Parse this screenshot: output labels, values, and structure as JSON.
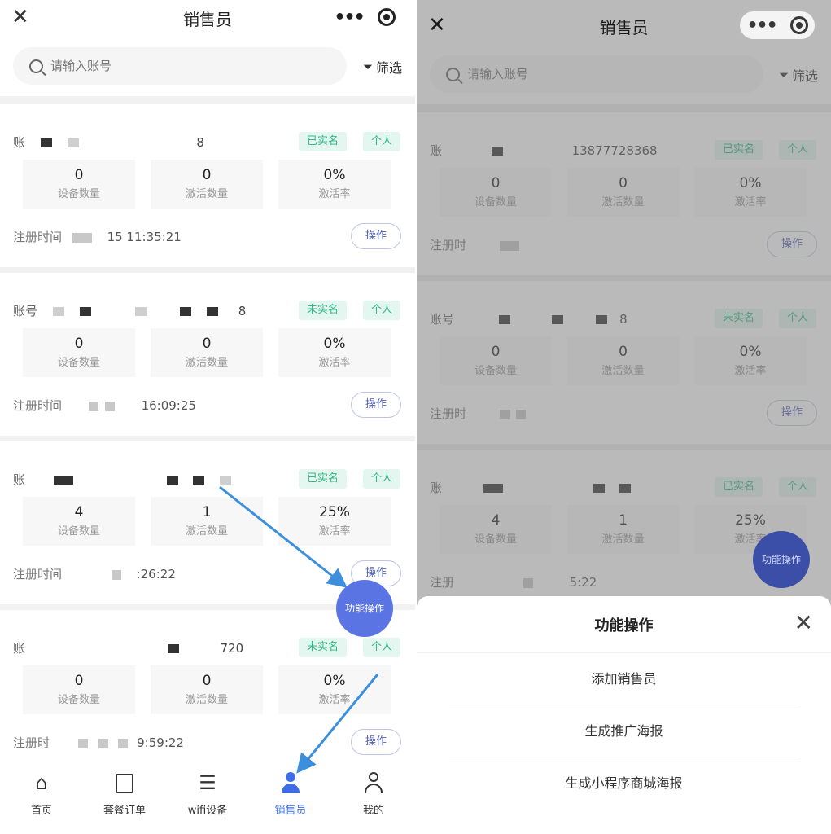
{
  "nav": {
    "title": "销售员",
    "close_icon": "close-icon",
    "more_icon": "more-dots-icon",
    "target_icon": "target-icon"
  },
  "search": {
    "placeholder": "请输入账号",
    "filter_label": "筛选"
  },
  "cards": [
    {
      "acct_label": "账",
      "acct_tail": "8",
      "verify": "已实名",
      "type": "个人",
      "devices": "0",
      "devices_label": "设备数量",
      "activated": "0",
      "activated_label": "激活数量",
      "rate": "0%",
      "rate_label": "激活率",
      "reg_label": "注册时间",
      "reg_time": "15 11:35:21",
      "op": "操作"
    },
    {
      "acct_label": "账号",
      "acct_tail": "8",
      "verify": "未实名",
      "type": "个人",
      "devices": "0",
      "devices_label": "设备数量",
      "activated": "0",
      "activated_label": "激活数量",
      "rate": "0%",
      "rate_label": "激活率",
      "reg_label": "注册时间",
      "reg_time": "16:09:25",
      "op": "操作"
    },
    {
      "acct_label": "账",
      "acct_tail": "",
      "verify": "已实名",
      "type": "个人",
      "devices": "4",
      "devices_label": "设备数量",
      "activated": "1",
      "activated_label": "激活数量",
      "rate": "25%",
      "rate_label": "激活率",
      "reg_label": "注册时间",
      "reg_time": ":26:22",
      "op": "操作"
    },
    {
      "acct_label": "账",
      "acct_tail": "720",
      "verify": "未实名",
      "type": "个人",
      "devices": "0",
      "devices_label": "设备数量",
      "activated": "0",
      "activated_label": "激活数量",
      "rate": "0%",
      "rate_label": "激活率",
      "reg_label": "注册时",
      "reg_time": "9:59:22",
      "op": "操作"
    }
  ],
  "right_cards": [
    {
      "acct_label": "账",
      "acct_tail": "13877728368",
      "reg_label": "注册时",
      "reg_time": ""
    },
    {
      "acct_label": "账号",
      "acct_tail": "8",
      "reg_label": "注册时",
      "reg_time": ""
    },
    {
      "acct_label": "账",
      "acct_tail": "",
      "reg_label": "注册",
      "reg_time": "5:22"
    }
  ],
  "fab": {
    "label": "功能操作"
  },
  "tabs": [
    {
      "label": "首页",
      "icon": "home-icon"
    },
    {
      "label": "套餐订单",
      "icon": "order-icon"
    },
    {
      "label": "wifi设备",
      "icon": "wifi-device-icon"
    },
    {
      "label": "销售员",
      "icon": "salesperson-icon"
    },
    {
      "label": "我的",
      "icon": "profile-icon"
    }
  ],
  "sheet": {
    "title": "功能操作",
    "options": [
      "添加销售员",
      "生成推广海报",
      "生成小程序商城海报"
    ]
  },
  "colors": {
    "accent": "#3d6ee8",
    "fab": "#5b74e3",
    "tag_bg": "#e3f6ef",
    "tag_text": "#2fb986",
    "arrow": "#3b8fdc"
  }
}
